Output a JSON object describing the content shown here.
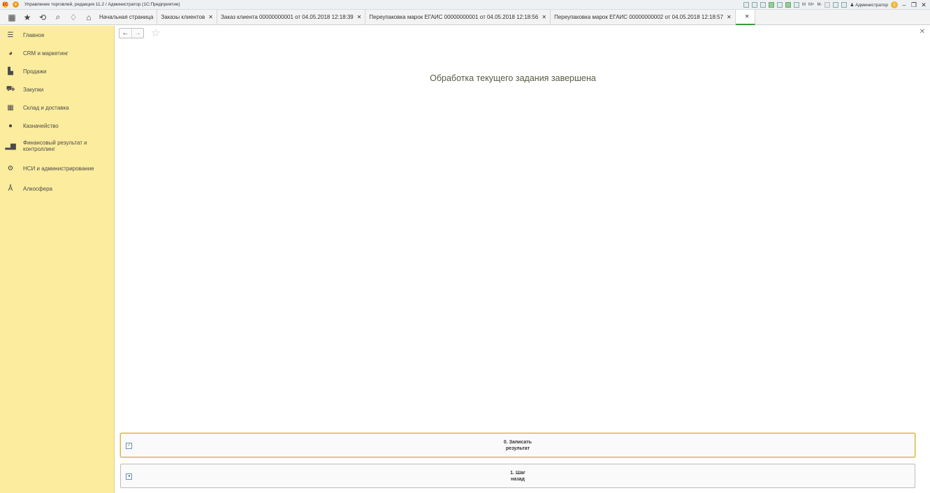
{
  "titlebar": {
    "title": "Управление торговлей, редакция 11.2 / Администратор  (1С:Предприятие)",
    "memory_labels": [
      "M",
      "M+",
      "M-"
    ],
    "user": "Администратор"
  },
  "tabs": [
    {
      "label": "Начальная страница",
      "closable": false
    },
    {
      "label": "Заказы клиентов",
      "closable": true
    },
    {
      "label": "Заказ клиента 00000000001 от 04.05.2018 12:18:39",
      "closable": true
    },
    {
      "label": "Переупаковка марок ЕГАИС 00000000001 от 04.05.2018 12:18:56",
      "closable": true
    },
    {
      "label": "Переупаковка марок ЕГАИС 00000000002 от 04.05.2018 12:18:57",
      "closable": true
    }
  ],
  "sidebar": {
    "items": [
      {
        "label": "Главное",
        "icon": "menu-icon"
      },
      {
        "label": "CRM и маркетинг",
        "icon": "pie-chart-icon"
      },
      {
        "label": "Продажи",
        "icon": "bag-icon"
      },
      {
        "label": "Закупки",
        "icon": "cart-icon"
      },
      {
        "label": "Склад и доставка",
        "icon": "warehouse-icon"
      },
      {
        "label": "Казначейство",
        "icon": "money-icon"
      },
      {
        "label": "Финансовый результат и контроллинг",
        "icon": "bar-chart-icon"
      },
      {
        "label": "НСИ и администрирование",
        "icon": "gear-icon"
      },
      {
        "label": "Алкосфера",
        "icon": "bottle-icon"
      }
    ]
  },
  "main": {
    "heading": "Обработка текущего задания завершена",
    "actions": [
      {
        "line1": "0. Записать",
        "line2": "результат",
        "icon": "save-document-icon"
      },
      {
        "line1": "1. Шаг",
        "line2": "назад",
        "icon": "step-back-icon"
      }
    ]
  },
  "colors": {
    "sidebar_bg": "#fcec9d",
    "active_tab_underline": "#3a9a3a",
    "focus_border": "#d2b44e"
  }
}
